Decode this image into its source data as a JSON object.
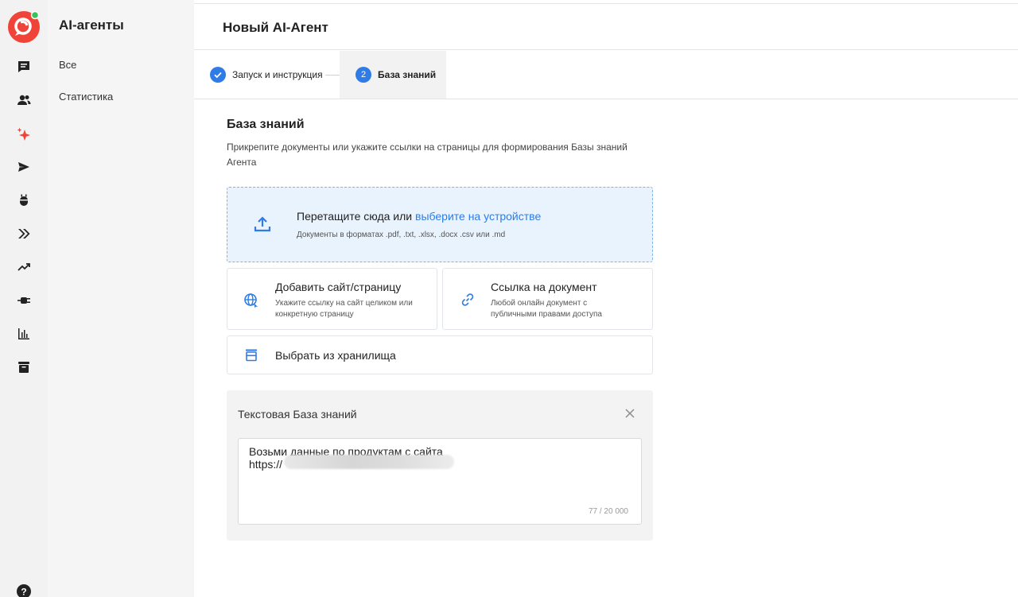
{
  "sidebar": {
    "title": "AI-агенты",
    "items": [
      {
        "label": "Все"
      },
      {
        "label": "Статистика"
      }
    ]
  },
  "rail": {
    "icons": [
      "chat-icon",
      "contacts-icon",
      "ai-sparkle-icon",
      "send-icon",
      "bot-icon",
      "forward-icon",
      "trend-icon",
      "plug-icon",
      "bar-chart-icon",
      "archive-icon",
      "help-icon"
    ],
    "active": "ai-sparkle-icon"
  },
  "header": {
    "title": "Новый AI-Агент"
  },
  "stepper": {
    "steps": [
      {
        "label": "Запуск и инструкция",
        "state": "done"
      },
      {
        "label": "База знаний",
        "number": "2",
        "state": "active"
      }
    ]
  },
  "knowledge": {
    "title": "База знаний",
    "description": "Прикрепите документы или укажите ссылки на страницы для формирования Базы знаний Агента",
    "dropzone": {
      "text": "Перетащите сюда или",
      "link": "выберите на устройстве",
      "formats": "Документы в форматах .pdf, .txt, .xlsx, .docx .csv или .md"
    },
    "add_site": {
      "title": "Добавить сайт/страницу",
      "subtitle": "Укажите ссылку на сайт целиком или конкретную страницу"
    },
    "doc_link": {
      "title": "Ссылка на документ",
      "subtitle": "Любой онлайн документ с публичными правами доступа"
    },
    "storage": {
      "title": "Выбрать из хранилища"
    },
    "text_kb": {
      "title": "Текстовая База знаний",
      "line1": "Возьми данные по продуктам с сайта",
      "line2": "https://",
      "counter": "77 / 20 000"
    }
  },
  "colors": {
    "accent": "#2f7ce6",
    "brand": "#f04438",
    "active_icon": "#f04438",
    "dropzone_bg": "#e9f3fd"
  }
}
